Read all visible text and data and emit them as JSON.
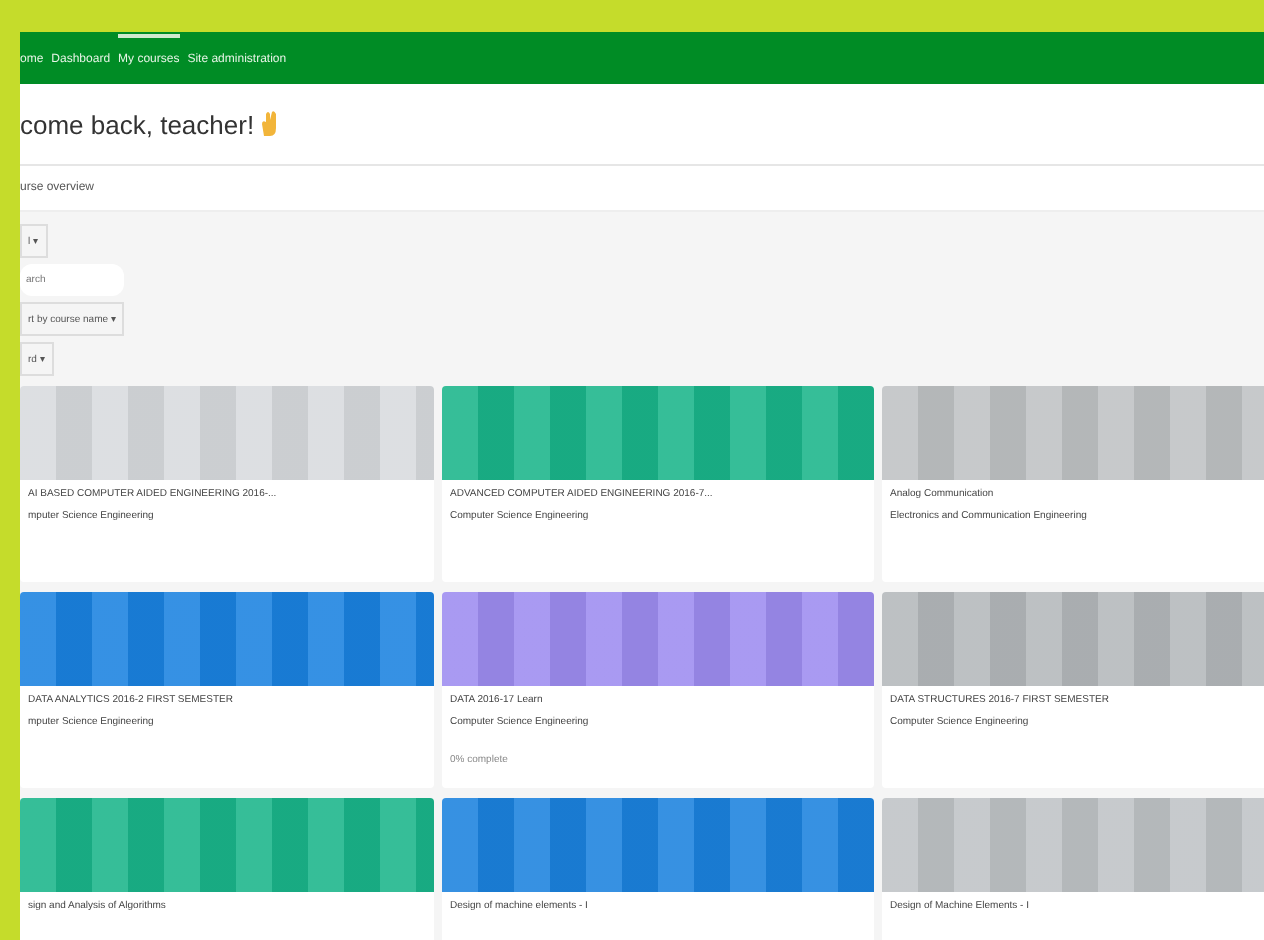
{
  "nav": {
    "items": [
      {
        "label": "ome",
        "selected": false
      },
      {
        "label": "Dashboard",
        "selected": false
      },
      {
        "label": "My courses",
        "selected": true
      },
      {
        "label": "Site administration",
        "selected": false
      }
    ]
  },
  "greeting": "come back, teacher!",
  "section_title": "urse overview",
  "filters": {
    "grouping": "l ▾",
    "search": {
      "placeholder": "arch"
    },
    "sort": "rt by course name ▾",
    "view": "rd ▾"
  },
  "courses": [
    {
      "name": "AI BASED COMPUTER AIDED ENGINEERING 2016-...",
      "category": "mputer Science Engineering",
      "color": "#d8dbde"
    },
    {
      "name": "ADVANCED COMPUTER AIDED ENGINEERING 2016-7...",
      "category": "Computer Science Engineering",
      "color": "#1ab58a"
    },
    {
      "name": "Analog Communication",
      "category": "Electronics and Communication Engineering",
      "color": "#bfc2c4"
    },
    {
      "name": "DATA ANALYTICS 2016-2 FIRST SEMESTER",
      "category": "mputer Science Engineering",
      "color": "#1a82e0"
    },
    {
      "name": "DATA 2016-17 Learn",
      "category": "Computer Science Engineering",
      "color": "#9d8cf0",
      "progress": "0% complete"
    },
    {
      "name": "DATA STRUCTURES 2016-7 FIRST SEMESTER",
      "category": "Computer Science Engineering",
      "color": "#b4b8bb"
    },
    {
      "name": "sign and Analysis of Algorithms",
      "color": "#1ab58a"
    },
    {
      "name": "Design of machine elements - I",
      "color": "#1b82de"
    },
    {
      "name": "Design of Machine Elements - I",
      "color": "#bfc3c6"
    }
  ]
}
